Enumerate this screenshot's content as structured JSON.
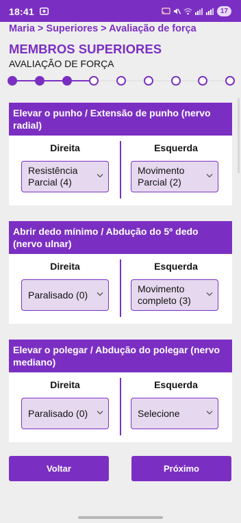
{
  "status_bar": {
    "time": "18:41",
    "battery": "17"
  },
  "breadcrumb": "Maria > Superiores > Avaliação de força",
  "title": "MEMBROS SUPERIORES",
  "subtitle": "AVALIAÇÃO DE FORÇA",
  "stepper": {
    "total_steps": 9,
    "completed_steps": 3,
    "current_step": 4
  },
  "sections": [
    {
      "title": "Elevar o punho / Extensão de punho (nervo radial)",
      "right_label": "Direita",
      "left_label": "Esquerda",
      "right_value": "Resistência Parcial (4)",
      "left_value": "Movimento Parcial (2)"
    },
    {
      "title": "Abrir dedo mínimo / Abdução do 5º dedo (nervo ulnar)",
      "right_label": "Direita",
      "left_label": "Esquerda",
      "right_value": "Paralisado (0)",
      "left_value": "Movimento completo (3)"
    },
    {
      "title": "Elevar o polegar / Abdução do polegar (nervo mediano)",
      "right_label": "Direita",
      "left_label": "Esquerda",
      "right_value": "Paralisado (0)",
      "left_value": "Selecione"
    }
  ],
  "buttons": {
    "back": "Voltar",
    "next": "Próximo"
  },
  "colors": {
    "primary": "#7b2fc2",
    "select_bg": "#e6d9ef",
    "page_bg": "#eeeeee",
    "pending": "#e4e4e4"
  },
  "icons": [
    "screen-record-icon",
    "cast-icon",
    "mute-icon",
    "wifi-icon",
    "signal-icon",
    "chevron-down-icon"
  ]
}
